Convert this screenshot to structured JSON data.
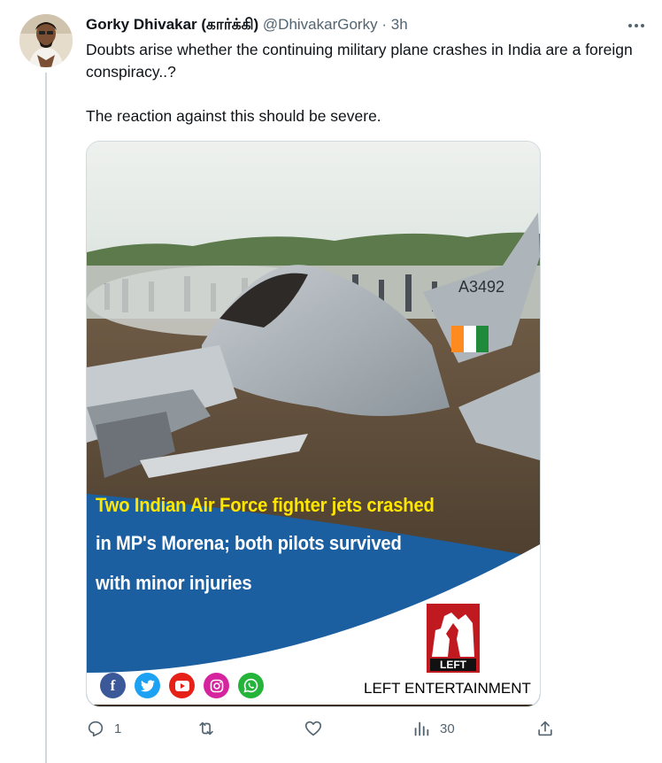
{
  "tweet": {
    "author_name": "Gorky Dhivakar (கார்க்கி)",
    "author_handle": "@DhivakarGorky",
    "separator": "·",
    "time": "3h",
    "text_line1": "Doubts arise whether the continuing military plane crashes in India are a foreign conspiracy..?",
    "text_line2": "The reaction against this should be severe."
  },
  "media": {
    "tail_number": "A3492",
    "headline_line1": "Two Indian Air Force fighter jets crashed",
    "headline_line2": "in MP's Morena; both pilots survived",
    "headline_line3": "with minor injuries",
    "logo_text": "LEFT",
    "brand": "LEFT ENTERTAINMENT",
    "social_icons": [
      "facebook-icon",
      "twitter-icon",
      "youtube-icon",
      "instagram-icon",
      "whatsapp-icon"
    ],
    "colors": {
      "headline_accent": "#ffe600",
      "banner_blue": "#1c5fa0",
      "logo_red": "#c0191f"
    }
  },
  "actions": {
    "reply_count": "1",
    "retweet_count": "",
    "like_count": "",
    "views_count": "30"
  }
}
